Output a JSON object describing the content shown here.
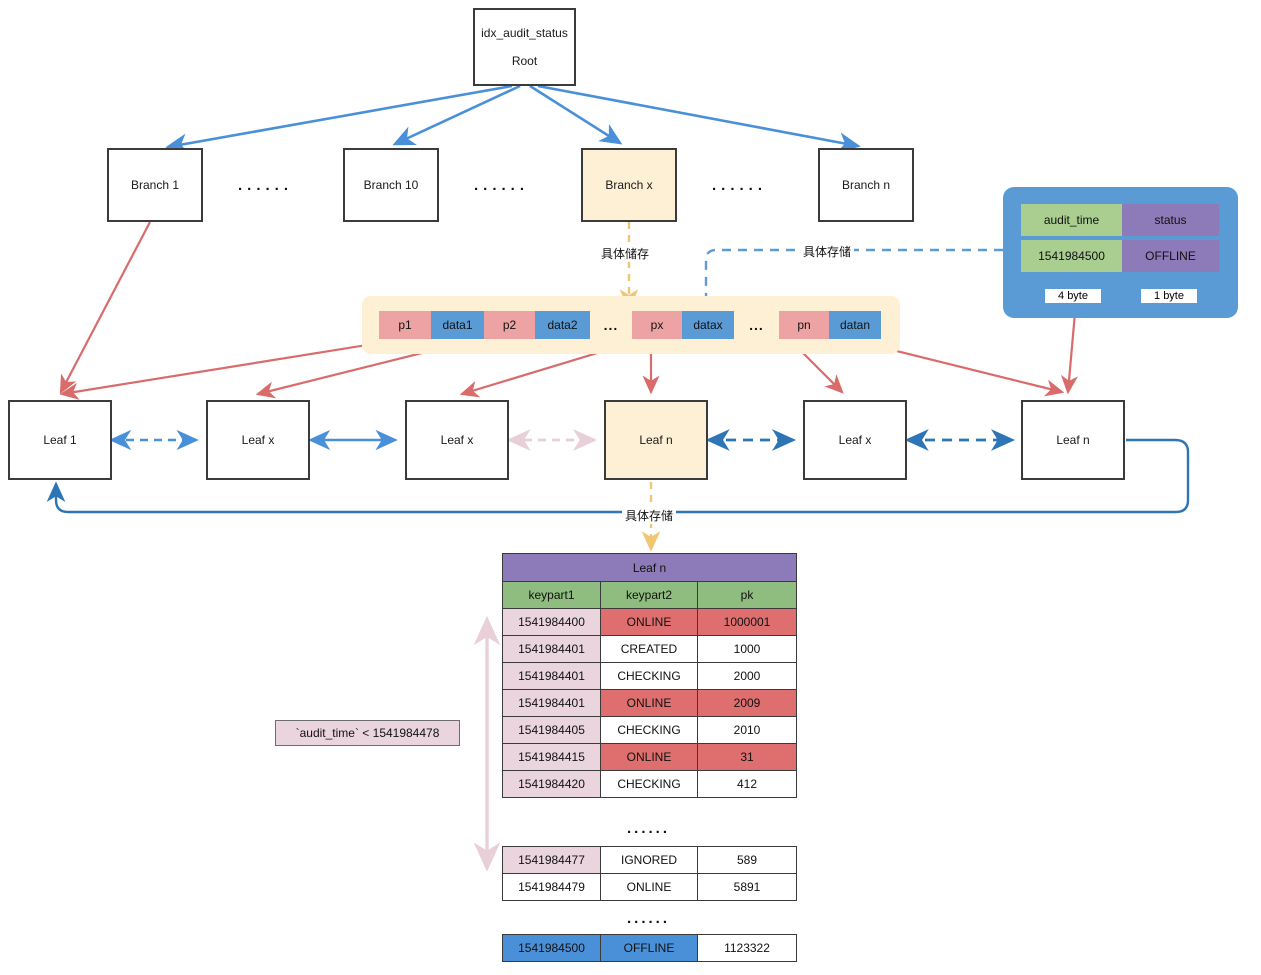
{
  "root": {
    "line1": "idx_audit_status",
    "line2": "Root"
  },
  "branches": [
    {
      "label": "Branch 1",
      "highlight": false
    },
    {
      "label": "Branch 10",
      "highlight": false
    },
    {
      "label": "Branch x",
      "highlight": true
    },
    {
      "label": "Branch n",
      "highlight": false
    }
  ],
  "branch_separators": [
    "......",
    "......",
    "......"
  ],
  "pointer_row": {
    "cells": [
      {
        "text": "p1",
        "kind": "pointer"
      },
      {
        "text": "data1",
        "kind": "data"
      },
      {
        "text": "p2",
        "kind": "pointer"
      },
      {
        "text": "data2",
        "kind": "data"
      },
      {
        "text": "...",
        "kind": "gap"
      },
      {
        "text": "px",
        "kind": "pointer"
      },
      {
        "text": "datax",
        "kind": "data"
      },
      {
        "text": "...",
        "kind": "gap"
      },
      {
        "text": "pn",
        "kind": "pointer"
      },
      {
        "text": "datan",
        "kind": "data"
      }
    ]
  },
  "leaves": [
    {
      "label": "Leaf 1",
      "highlight": false
    },
    {
      "label": "Leaf x",
      "highlight": false
    },
    {
      "label": "Leaf x",
      "highlight": false
    },
    {
      "label": "Leaf n",
      "highlight": true
    },
    {
      "label": "Leaf x",
      "highlight": false
    },
    {
      "label": "Leaf n",
      "highlight": false
    }
  ],
  "annotations": {
    "branch_to_pointers": "具体储存",
    "legend_to_pointers": "具体存储",
    "leaf_to_table": "具体存储",
    "filter_note": "`audit_time` < 1541984478"
  },
  "legend": {
    "header": [
      "audit_time",
      "status"
    ],
    "values": [
      "1541984500",
      "OFFLINE"
    ],
    "sizes": [
      "4 byte",
      "1 byte"
    ]
  },
  "table": {
    "title": "Leaf n",
    "headers": [
      "keypart1",
      "keypart2",
      "pk"
    ],
    "group1": [
      {
        "cells": [
          "1541984400",
          "ONLINE",
          "1000001"
        ],
        "style": "red"
      },
      {
        "cells": [
          "1541984401",
          "CREATED",
          "1000"
        ],
        "style": "normal"
      },
      {
        "cells": [
          "1541984401",
          "CHECKING",
          "2000"
        ],
        "style": "normal"
      },
      {
        "cells": [
          "1541984401",
          "ONLINE",
          "2009"
        ],
        "style": "red"
      },
      {
        "cells": [
          "1541984405",
          "CHECKING",
          "2010"
        ],
        "style": "normal"
      },
      {
        "cells": [
          "1541984415",
          "ONLINE",
          "31"
        ],
        "style": "red"
      },
      {
        "cells": [
          "1541984420",
          "CHECKING",
          "412"
        ],
        "style": "normal"
      }
    ],
    "ellipsis1": "......",
    "group2": [
      {
        "cells": [
          "1541984477",
          "IGNORED",
          "589"
        ],
        "style": "normal"
      },
      {
        "cells": [
          "1541984479",
          "ONLINE",
          "5891"
        ],
        "style": "plain"
      }
    ],
    "ellipsis2": "......",
    "group3": [
      {
        "cells": [
          "1541984500",
          "OFFLINE",
          "1123322"
        ],
        "style": "blue"
      }
    ]
  },
  "colors": {
    "blue": "#4a90d9",
    "red": "#d96b6b",
    "pink_light": "#e8cfd8",
    "yellow": "#f0c674",
    "cream": "#fdf0d5",
    "green": "#8fbc7f",
    "purple": "#8d7ab8",
    "pointer_red": "#eda3a3",
    "data_blue": "#5b9bd5"
  }
}
